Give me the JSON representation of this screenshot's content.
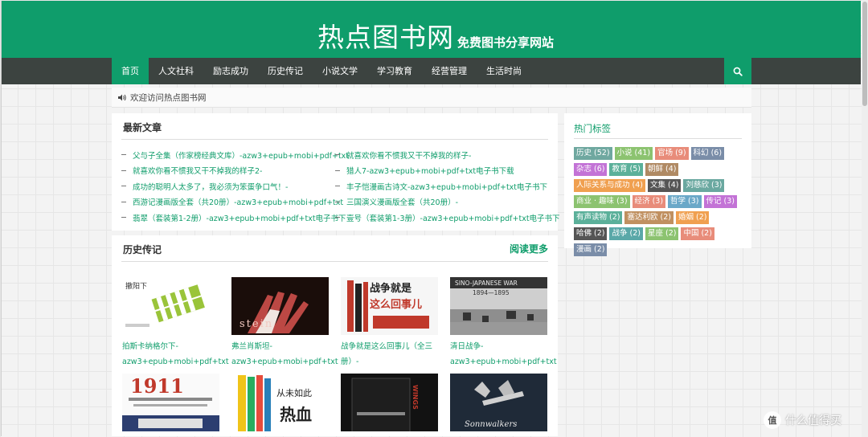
{
  "header": {
    "site_name": "热点图书网",
    "subtitle": "免费图书分享网站"
  },
  "nav": {
    "items": [
      "首页",
      "人文社科",
      "励志成功",
      "历史传记",
      "小说文学",
      "学习教育",
      "经营管理",
      "生活时尚"
    ],
    "search_icon": "search-icon"
  },
  "notice": {
    "text": "欢迎访问热点图书网",
    "icon": "speaker-icon"
  },
  "latest": {
    "title": "最新文章",
    "left": [
      "父与子全集（作家榜经典文库）-azw3+epub+mobi+pdf+txt",
      "就喜欢你看不惯我又干不掉我的样子2-",
      "成功的聪明人太多了，我必须为笨蛋争口气！-",
      "西游记漫画版全套（共20册）-azw3+epub+mobi+pdf+txt",
      "翡翠（套装第1-2册）-azw3+epub+mobi+pdf+txt电子书下"
    ],
    "right": [
      "就喜欢你看不惯我又干不掉我的样子-",
      "猎人7-azw3+epub+mobi+pdf+txt电子书下载",
      "丰子恺漫画古诗文-azw3+epub+mobi+pdf+txt电子书下",
      "三国演义漫画版全套（共20册）-",
      "壹号（套装第1-3册）-azw3+epub+mobi+pdf+txt电子书下"
    ]
  },
  "history": {
    "title": "历史传记",
    "more": "阅读更多",
    "books": [
      {
        "line1": "拍斯卡纳格尔下-",
        "line2": "azw3+epub+mobi+pdf+txt"
      },
      {
        "line1": "弗兰肖斯坦-",
        "line2": "azw3+epub+mobi+pdf+txt"
      },
      {
        "line1": "战争就是这么回事儿（全三",
        "line2": "册）-"
      },
      {
        "line1": "清日战争-",
        "line2": "azw3+epub+mobi+pdf+txt"
      }
    ],
    "covers_row1": {
      "c1_text": "撤阳下",
      "c2_text": "stein",
      "c3_line1": "战争就是",
      "c3_line2": "这么回事儿",
      "c4_line1": "SINO-JAPANESE WAR",
      "c4_line2": "1894—1895"
    },
    "covers_row2": {
      "c1_text": "1911",
      "c2_line1": "从未如此",
      "c2_line2": "热血",
      "c3_text": "WINGS",
      "c4_text": "Sonnwalkers"
    }
  },
  "tags": {
    "title": "热门标签",
    "items": [
      {
        "label": "历史 (52)",
        "color": "#6fa8a0"
      },
      {
        "label": "小说 (41)",
        "color": "#8cc370"
      },
      {
        "label": "官场 (9)",
        "color": "#e88c7a"
      },
      {
        "label": "科幻 (6)",
        "color": "#7a8da8"
      },
      {
        "label": "杂志 (6)",
        "color": "#c373d6"
      },
      {
        "label": "教育 (5)",
        "color": "#5bb09a"
      },
      {
        "label": "朝鲜 (4)",
        "color": "#b08a64"
      },
      {
        "label": "人际关系与成功 (4)",
        "color": "#f0a050"
      },
      {
        "label": "文集 (4)",
        "color": "#555555"
      },
      {
        "label": "刘慈欣 (3)",
        "color": "#6aa8a0"
      },
      {
        "label": "商业 · 趣味 (3)",
        "color": "#8cc370"
      },
      {
        "label": "经济 (3)",
        "color": "#e88c7a"
      },
      {
        "label": "哲学 (3)",
        "color": "#6aa8c8"
      },
      {
        "label": "传记 (3)",
        "color": "#c373d6"
      },
      {
        "label": "有声读物 (2)",
        "color": "#5bb09a"
      },
      {
        "label": "塞达利欧 (2)",
        "color": "#c09060"
      },
      {
        "label": "婚姻 (2)",
        "color": "#f0a050"
      },
      {
        "label": "哈佛 (2)",
        "color": "#555555"
      },
      {
        "label": "战争 (2)",
        "color": "#5aa8a8"
      },
      {
        "label": "星座 (2)",
        "color": "#8cc370"
      },
      {
        "label": "中国 (2)",
        "color": "#e88c7a"
      },
      {
        "label": "漫画 (2)",
        "color": "#7a8da8"
      }
    ]
  },
  "watermark": {
    "badge": "值",
    "text": "什么值得买"
  }
}
